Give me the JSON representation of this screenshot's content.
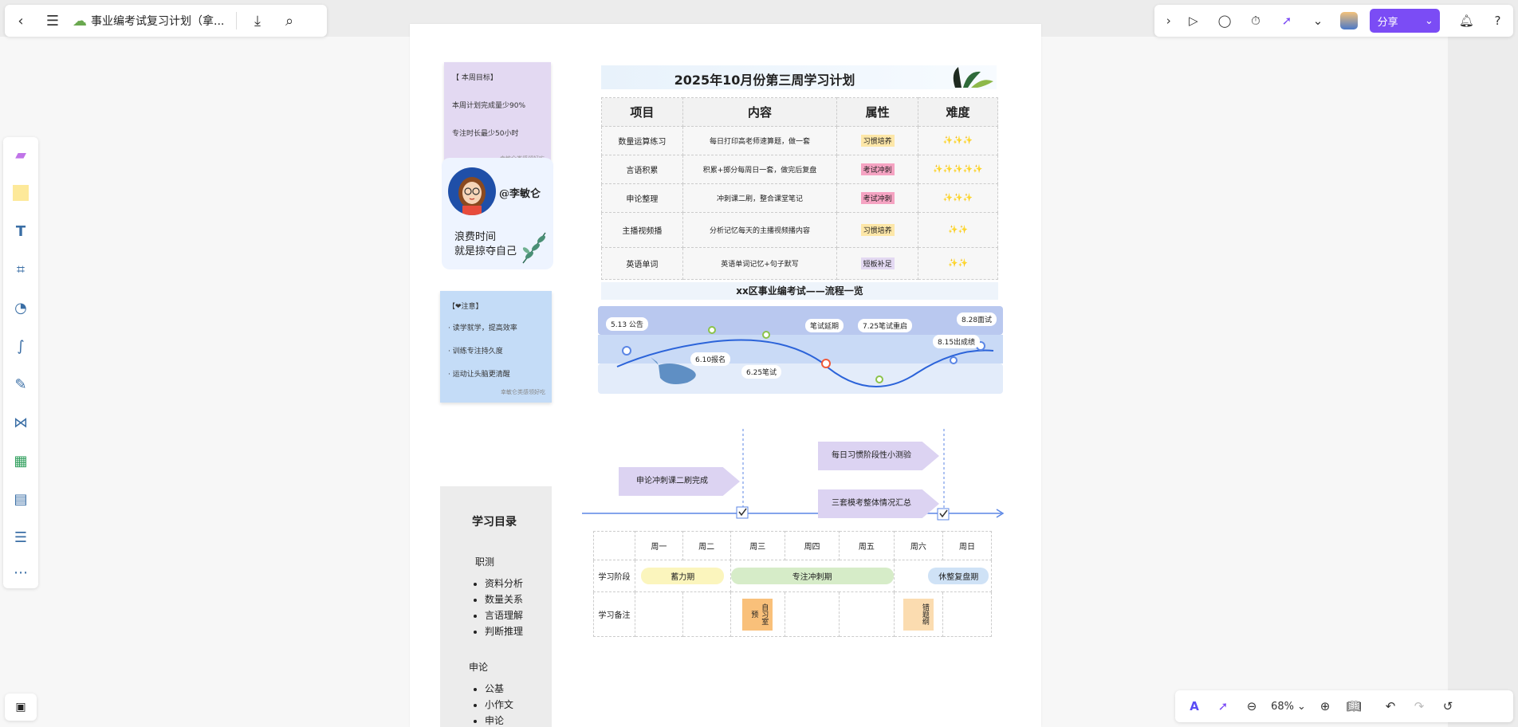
{
  "header": {
    "doc_title": "事业编考试复习计划（拿...",
    "share_label": "分享"
  },
  "plan_title": "2025年10月份第三周学习计划",
  "goal_note": {
    "title": "【 本周目标】",
    "line1": "本周计划完成量少90%",
    "line2": "专注时长最少50小时",
    "footer": "幸敏仑类感领好吃"
  },
  "profile": {
    "handle": "@李敏仑",
    "quote1": "浪费时间",
    "quote2": "就是掠夺自己"
  },
  "attention_note": {
    "title": "【❤注意】",
    "items": [
      "· 读学就学，提高效率",
      "· 训练专注持久度",
      "· 运动让头脑更清醒"
    ],
    "footer": "幸敏仑类感领好吃"
  },
  "table": {
    "headers": [
      "项目",
      "内容",
      "属性",
      "难度"
    ],
    "rows": [
      {
        "item": "数量运算练习",
        "content": "每日打印高老师速算题，做一套",
        "attr": "习惯培养",
        "diff": "✨✨✨"
      },
      {
        "item": "言语积累",
        "content": "积累+掷分每周日一套，做完后复盘",
        "attr": "考试冲刺",
        "diff": "✨✨✨✨✨"
      },
      {
        "item": "申论整理",
        "content": "冲刺课二刷，整合课堂笔记",
        "attr": "考试冲刺",
        "diff": "✨✨✨"
      },
      {
        "item": "主播视频播",
        "content": "分析记忆每天的主播视频播内容",
        "attr": "习惯培养",
        "diff": "✨✨"
      },
      {
        "item": "英语单词",
        "content": "英语单词记忆+句子默写",
        "attr": "短板补足",
        "diff": "✨✨"
      }
    ]
  },
  "process": {
    "title": "xx区事业编考试——流程一览",
    "labels": [
      "5.13 公告",
      "6.10报名",
      "6.25笔试",
      "笔试延期",
      "7.25笔试重启",
      "8.15出成绩",
      "8.28面试"
    ]
  },
  "catalog": {
    "title": "学习目录",
    "sec1": "职测",
    "sec1_items": [
      "资料分析",
      "数量关系",
      "言语理解",
      "判断推理"
    ],
    "sec2": "申论",
    "sec2_items": [
      "公基",
      "小作文",
      "申论"
    ]
  },
  "timeline": {
    "arrow1": "申论冲刺课二刷完成",
    "arrow2": "每日习惯阶段性小测验",
    "arrow3": "三套模考整体情况汇总"
  },
  "weekly": {
    "days": [
      "周一",
      "周二",
      "周三",
      "周四",
      "周五",
      "周六",
      "周日"
    ],
    "row1_label": "学习阶段",
    "phase1": "蓄力期",
    "phase2": "专注冲刺期",
    "phase3": "休整复盘期",
    "row2_label": "学习备注",
    "note_wed": "自习室预",
    "note_sat": "错题纲"
  },
  "zoom": "68%"
}
